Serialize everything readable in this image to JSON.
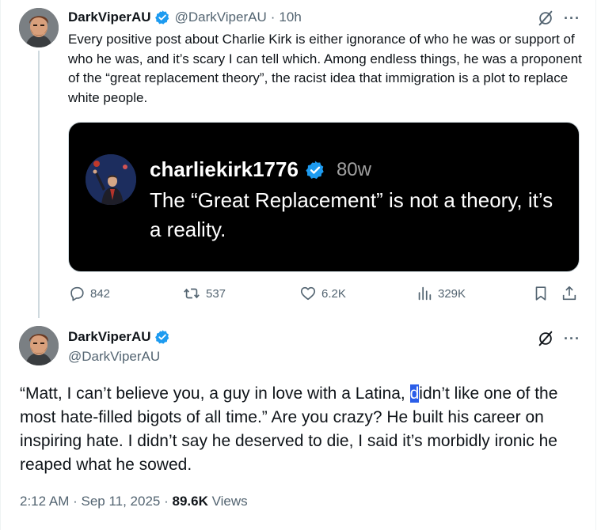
{
  "tweet1": {
    "display_name": "DarkViperAU",
    "handle": "@DarkViperAU",
    "separator": "·",
    "time": "10h",
    "text": "Every positive post about Charlie Kirk is either ignorance of who he was or support of who he was, and it’s scary I can tell which. Among endless things, he was a proponent of the “great replacement theory”, the racist idea that immigration is a plot to replace white people.",
    "media": {
      "username": "charliekirk1776",
      "age": "80w",
      "text": "The “Great Replacement” is not a theory, it’s a reality."
    },
    "actions": {
      "replies": "842",
      "reposts": "537",
      "likes": "6.2K",
      "views": "329K"
    }
  },
  "tweet2": {
    "display_name": "DarkViperAU",
    "handle": "@DarkViperAU",
    "text_before": "“Matt, I can’t believe you, a guy in love with a Latina, ",
    "text_selected": "d",
    "text_after": "idn’t like one of the most hate-filled bigots of all time.” Are you crazy? He built his career on inspiring hate. I didn’t say he deserved to die, I said it’s morbidly ironic he reaped what he sowed.",
    "timestamp": "2:12 AM · Sep 11, 2025 · ",
    "views_count": "89.6K",
    "views_label": " Views"
  },
  "icons": {
    "verified": "verified-badge-icon",
    "grok": "grok-icon",
    "more": "more-icon",
    "more_glyph": "···",
    "reply": "reply-icon",
    "repost": "repost-icon",
    "like": "like-icon",
    "views": "views-icon",
    "bookmark": "bookmark-icon",
    "share": "share-icon"
  },
  "colors": {
    "verified_blue": "#1d9bf0",
    "secondary_text": "#536471",
    "selection": "#2b5ee8"
  }
}
